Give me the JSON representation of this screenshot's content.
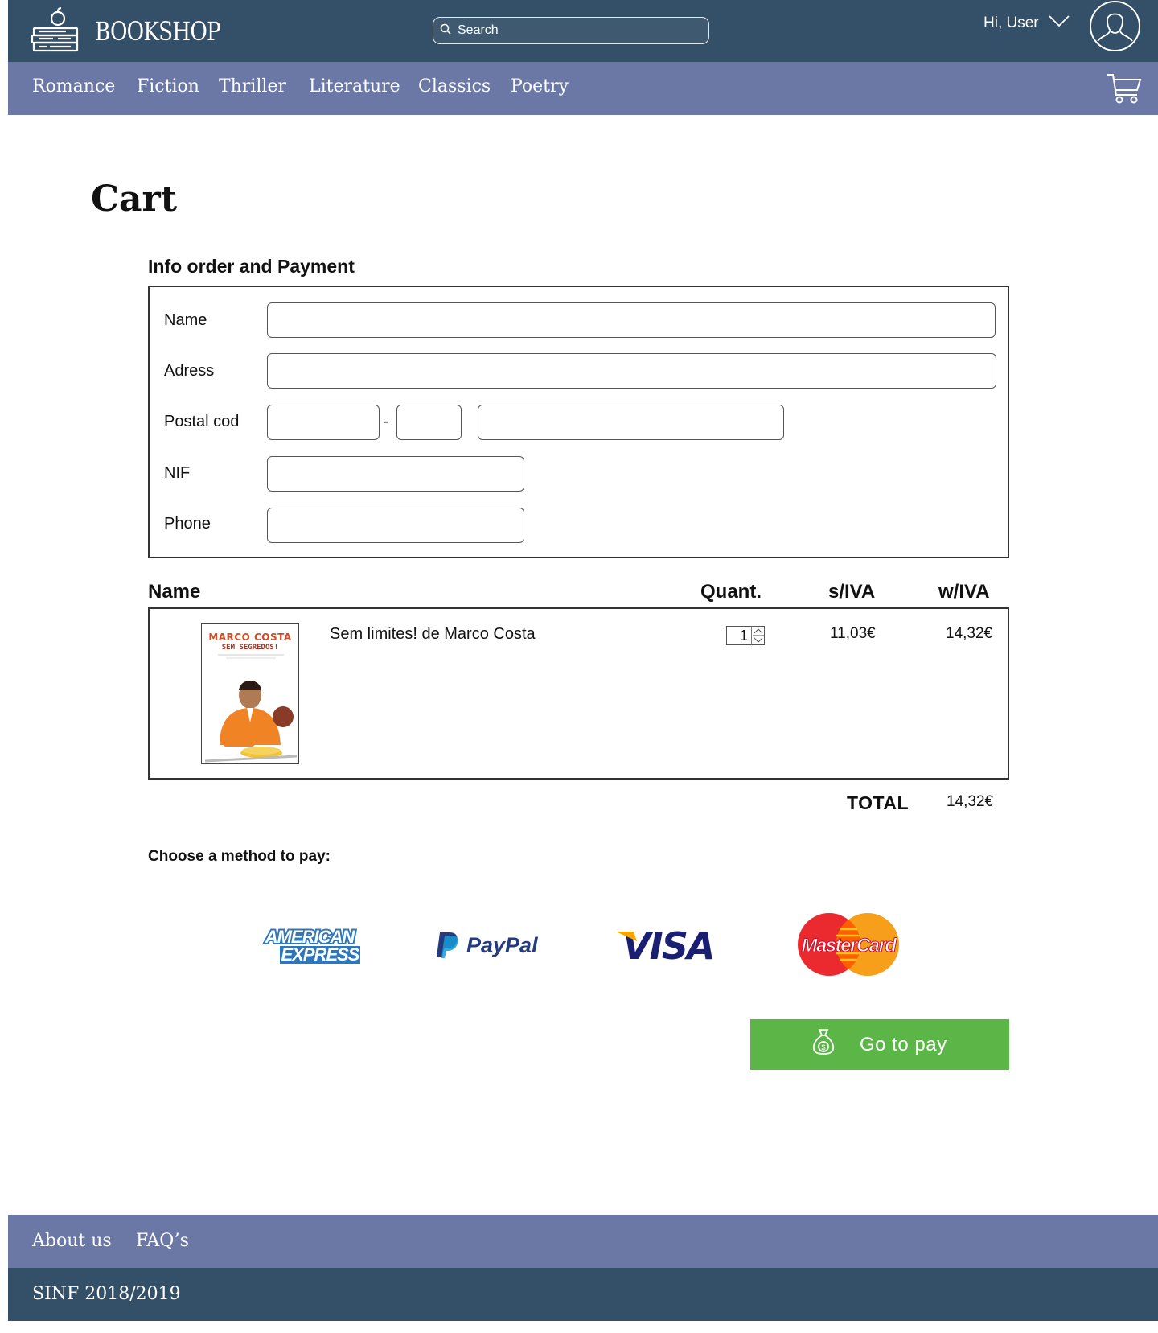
{
  "header": {
    "brand": "BOOKSHOP",
    "search_placeholder": "Search",
    "greeting": "Hi, User"
  },
  "nav": {
    "items": [
      "Romance",
      "Fiction",
      "Thriller",
      "Literature",
      "Classics",
      "Poetry"
    ]
  },
  "page": {
    "title": "Cart",
    "section_title": "Info order and Payment"
  },
  "form": {
    "name_label": "Name",
    "address_label": "Adress",
    "postal_label": "Postal cod",
    "postal_separator": "-",
    "nif_label": "NIF",
    "phone_label": "Phone"
  },
  "cart_table": {
    "headers": {
      "name": "Name",
      "quantity": "Quant.",
      "without_tax": "s/IVA",
      "with_tax": "w/IVA"
    },
    "items": [
      {
        "title": "Sem limites! de Marco Costa",
        "cover_author": "MARCO COSTA",
        "cover_subtitle": "SEM SEGREDOS!",
        "quantity": "1",
        "price_without_tax": "11,03€",
        "price_with_tax": "14,32€"
      }
    ]
  },
  "totals": {
    "label": "TOTAL",
    "value": "14,32€"
  },
  "payment": {
    "prompt": "Choose a method to pay:",
    "methods": [
      {
        "id": "amex",
        "line1": "AMERICAN",
        "line2": "EXPRESS",
        "icon": "american-express-logo"
      },
      {
        "id": "paypal",
        "text": "PayPal",
        "icon": "paypal-logo"
      },
      {
        "id": "visa",
        "text": "VISA",
        "icon": "visa-logo"
      },
      {
        "id": "mastercard",
        "text": "MasterCard",
        "icon": "mastercard-logo"
      }
    ],
    "cta_label": "Go to pay",
    "cta_icon": "money-bag-icon"
  },
  "footer": {
    "links": [
      "About us",
      "FAQ’s"
    ],
    "copyright": "SINF 2018/2019"
  },
  "colors": {
    "header_dark": "#344f68",
    "nav_light": "#6b78a5",
    "pay_green": "#5bb647",
    "paypal_dark": "#253b80",
    "paypal_light": "#179bd7",
    "visa_blue": "#1a1f71",
    "visa_gold": "#f7a600",
    "mc_red": "#eb001b",
    "mc_orange": "#f79e1b",
    "amex_blue": "#2e77bb"
  }
}
